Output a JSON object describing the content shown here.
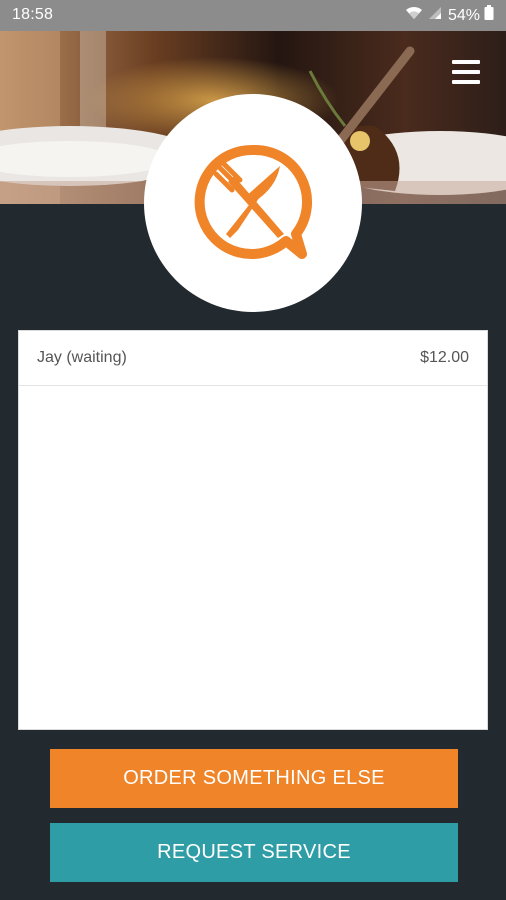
{
  "status_bar": {
    "time": "18:58",
    "battery": "54%",
    "icons": [
      "wifi-icon",
      "signal-icon",
      "battery-icon"
    ]
  },
  "header": {
    "menu_icon": "hamburger-menu-icon",
    "logo_icon": "knife-fork-chat-bubble-icon"
  },
  "orders": [
    {
      "name": "Jay (waiting)",
      "price": "$12.00"
    }
  ],
  "actions": {
    "order_label": "ORDER SOMETHING ELSE",
    "service_label": "REQUEST SERVICE"
  },
  "colors": {
    "accent_orange": "#f08428",
    "accent_teal": "#2f9da6",
    "background_dark": "#232a2f"
  }
}
